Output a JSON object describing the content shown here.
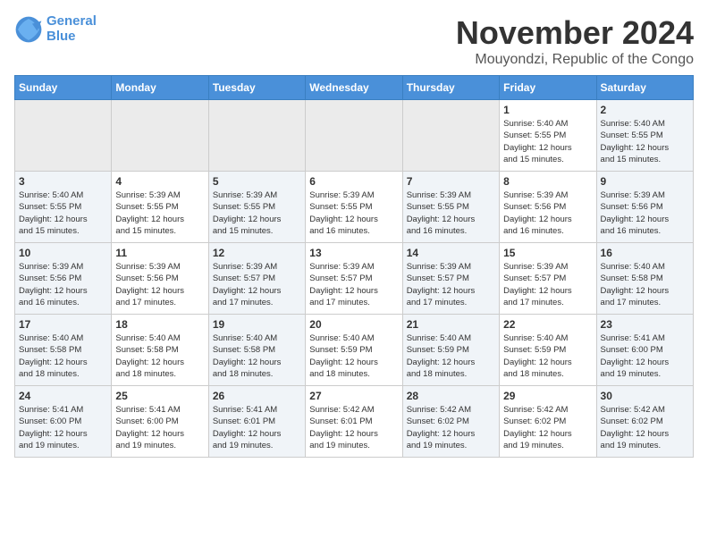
{
  "logo": {
    "line1": "General",
    "line2": "Blue"
  },
  "title": "November 2024",
  "subtitle": "Mouyondzi, Republic of the Congo",
  "days_header": [
    "Sunday",
    "Monday",
    "Tuesday",
    "Wednesday",
    "Thursday",
    "Friday",
    "Saturday"
  ],
  "weeks": [
    [
      {
        "day": "",
        "info": ""
      },
      {
        "day": "",
        "info": ""
      },
      {
        "day": "",
        "info": ""
      },
      {
        "day": "",
        "info": ""
      },
      {
        "day": "",
        "info": ""
      },
      {
        "day": "1",
        "info": "Sunrise: 5:40 AM\nSunset: 5:55 PM\nDaylight: 12 hours\nand 15 minutes."
      },
      {
        "day": "2",
        "info": "Sunrise: 5:40 AM\nSunset: 5:55 PM\nDaylight: 12 hours\nand 15 minutes."
      }
    ],
    [
      {
        "day": "3",
        "info": "Sunrise: 5:40 AM\nSunset: 5:55 PM\nDaylight: 12 hours\nand 15 minutes."
      },
      {
        "day": "4",
        "info": "Sunrise: 5:39 AM\nSunset: 5:55 PM\nDaylight: 12 hours\nand 15 minutes."
      },
      {
        "day": "5",
        "info": "Sunrise: 5:39 AM\nSunset: 5:55 PM\nDaylight: 12 hours\nand 15 minutes."
      },
      {
        "day": "6",
        "info": "Sunrise: 5:39 AM\nSunset: 5:55 PM\nDaylight: 12 hours\nand 16 minutes."
      },
      {
        "day": "7",
        "info": "Sunrise: 5:39 AM\nSunset: 5:55 PM\nDaylight: 12 hours\nand 16 minutes."
      },
      {
        "day": "8",
        "info": "Sunrise: 5:39 AM\nSunset: 5:56 PM\nDaylight: 12 hours\nand 16 minutes."
      },
      {
        "day": "9",
        "info": "Sunrise: 5:39 AM\nSunset: 5:56 PM\nDaylight: 12 hours\nand 16 minutes."
      }
    ],
    [
      {
        "day": "10",
        "info": "Sunrise: 5:39 AM\nSunset: 5:56 PM\nDaylight: 12 hours\nand 16 minutes."
      },
      {
        "day": "11",
        "info": "Sunrise: 5:39 AM\nSunset: 5:56 PM\nDaylight: 12 hours\nand 17 minutes."
      },
      {
        "day": "12",
        "info": "Sunrise: 5:39 AM\nSunset: 5:57 PM\nDaylight: 12 hours\nand 17 minutes."
      },
      {
        "day": "13",
        "info": "Sunrise: 5:39 AM\nSunset: 5:57 PM\nDaylight: 12 hours\nand 17 minutes."
      },
      {
        "day": "14",
        "info": "Sunrise: 5:39 AM\nSunset: 5:57 PM\nDaylight: 12 hours\nand 17 minutes."
      },
      {
        "day": "15",
        "info": "Sunrise: 5:39 AM\nSunset: 5:57 PM\nDaylight: 12 hours\nand 17 minutes."
      },
      {
        "day": "16",
        "info": "Sunrise: 5:40 AM\nSunset: 5:58 PM\nDaylight: 12 hours\nand 17 minutes."
      }
    ],
    [
      {
        "day": "17",
        "info": "Sunrise: 5:40 AM\nSunset: 5:58 PM\nDaylight: 12 hours\nand 18 minutes."
      },
      {
        "day": "18",
        "info": "Sunrise: 5:40 AM\nSunset: 5:58 PM\nDaylight: 12 hours\nand 18 minutes."
      },
      {
        "day": "19",
        "info": "Sunrise: 5:40 AM\nSunset: 5:58 PM\nDaylight: 12 hours\nand 18 minutes."
      },
      {
        "day": "20",
        "info": "Sunrise: 5:40 AM\nSunset: 5:59 PM\nDaylight: 12 hours\nand 18 minutes."
      },
      {
        "day": "21",
        "info": "Sunrise: 5:40 AM\nSunset: 5:59 PM\nDaylight: 12 hours\nand 18 minutes."
      },
      {
        "day": "22",
        "info": "Sunrise: 5:40 AM\nSunset: 5:59 PM\nDaylight: 12 hours\nand 18 minutes."
      },
      {
        "day": "23",
        "info": "Sunrise: 5:41 AM\nSunset: 6:00 PM\nDaylight: 12 hours\nand 19 minutes."
      }
    ],
    [
      {
        "day": "24",
        "info": "Sunrise: 5:41 AM\nSunset: 6:00 PM\nDaylight: 12 hours\nand 19 minutes."
      },
      {
        "day": "25",
        "info": "Sunrise: 5:41 AM\nSunset: 6:00 PM\nDaylight: 12 hours\nand 19 minutes."
      },
      {
        "day": "26",
        "info": "Sunrise: 5:41 AM\nSunset: 6:01 PM\nDaylight: 12 hours\nand 19 minutes."
      },
      {
        "day": "27",
        "info": "Sunrise: 5:42 AM\nSunset: 6:01 PM\nDaylight: 12 hours\nand 19 minutes."
      },
      {
        "day": "28",
        "info": "Sunrise: 5:42 AM\nSunset: 6:02 PM\nDaylight: 12 hours\nand 19 minutes."
      },
      {
        "day": "29",
        "info": "Sunrise: 5:42 AM\nSunset: 6:02 PM\nDaylight: 12 hours\nand 19 minutes."
      },
      {
        "day": "30",
        "info": "Sunrise: 5:42 AM\nSunset: 6:02 PM\nDaylight: 12 hours\nand 19 minutes."
      }
    ]
  ]
}
